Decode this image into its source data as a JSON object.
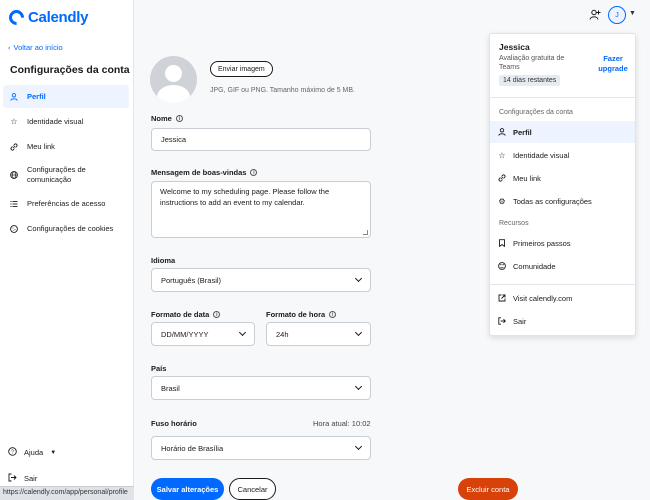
{
  "app": {
    "brand": "Calendly"
  },
  "sidebar": {
    "back_label": "Voltar ao início",
    "title": "Configurações da conta",
    "items": [
      {
        "label": "Perfil",
        "icon": "person-icon"
      },
      {
        "label": "Identidade visual",
        "icon": "star-icon"
      },
      {
        "label": "Meu link",
        "icon": "link-icon"
      },
      {
        "label": "Configurações de comunicação",
        "icon": "globe-icon"
      },
      {
        "label": "Preferências de acesso",
        "icon": "list-icon"
      },
      {
        "label": "Configurações de cookies",
        "icon": "cookie-icon"
      }
    ],
    "help_label": "Ajuda",
    "exit_label": "Sair"
  },
  "status_bar": {
    "url": "https://calendly.com/app/personal/profile"
  },
  "topbar": {
    "avatar_initial": "J"
  },
  "profile": {
    "upload_label": "Enviar imagem",
    "upload_hint": "JPG, GIF ou PNG. Tamanho máximo de 5 MB.",
    "name_label": "Nome",
    "name_value": "Jessica",
    "welcome_label": "Mensagem de boas-vindas",
    "welcome_value": "Welcome to my scheduling page. Please follow the instructions to add an event to my calendar.",
    "language_label": "Idioma",
    "language_value": "Português (Brasil)",
    "date_format_label": "Formato de data",
    "date_format_value": "DD/MM/YYYY",
    "time_format_label": "Formato de hora",
    "time_format_value": "24h",
    "country_label": "País",
    "country_value": "Brasil",
    "timezone_label": "Fuso horário",
    "current_time_label": "Hora atual:  10:02",
    "timezone_value": "Horário de Brasília",
    "save_label": "Salvar alterações",
    "cancel_label": "Cancelar",
    "delete_label": "Excluir conta"
  },
  "menu": {
    "user_name": "Jessica",
    "trial_text": "Avaliação gratuita de Teams",
    "days_badge": "14 dias restantes",
    "upgrade_label": "Fazer upgrade",
    "account_section": "Configurações da conta",
    "account_items": [
      {
        "label": "Perfil",
        "icon": "person-icon"
      },
      {
        "label": "Identidade visual",
        "icon": "star-icon"
      },
      {
        "label": "Meu link",
        "icon": "link-icon"
      },
      {
        "label": "Todas as configurações",
        "icon": "gear-icon"
      }
    ],
    "resources_section": "Recursos",
    "resource_items": [
      {
        "label": "Primeiros passos",
        "icon": "bookmark-icon"
      },
      {
        "label": "Comunidade",
        "icon": "community-icon"
      }
    ],
    "visit_label": "Visit calendly.com",
    "exit_label": "Sair"
  },
  "colors": {
    "accent": "#0069ff",
    "danger": "#d9410b",
    "active_bg": "#eef4ff"
  }
}
